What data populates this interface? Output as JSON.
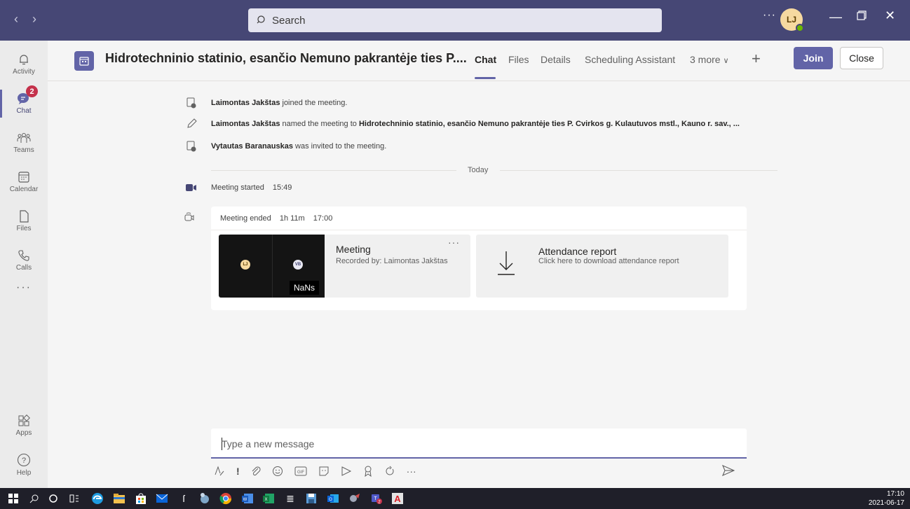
{
  "titlebar": {
    "search_placeholder": "Search",
    "more_label": "···",
    "avatar_initials": "LJ"
  },
  "rail": {
    "items": [
      {
        "label": "Activity",
        "icon": "bell-icon"
      },
      {
        "label": "Chat",
        "icon": "chat-icon",
        "badge": "2"
      },
      {
        "label": "Teams",
        "icon": "teams-icon"
      },
      {
        "label": "Calendar",
        "icon": "calendar-icon"
      },
      {
        "label": "Files",
        "icon": "file-icon"
      },
      {
        "label": "Calls",
        "icon": "phone-icon"
      },
      {
        "label": "Apps",
        "icon": "apps-icon"
      },
      {
        "label": "Help",
        "icon": "help-icon"
      }
    ],
    "more_label": "···"
  },
  "header": {
    "title": "Hidrotechninio statinio, esančio Nemuno pakrantėje ties P....",
    "tabs": [
      "Chat",
      "Files",
      "Details",
      "Scheduling Assistant",
      "3 more"
    ],
    "active_tab": "Chat",
    "join_label": "Join",
    "close_label": "Close"
  },
  "events": [
    {
      "name": "Laimontas Jakštas",
      "text": " joined the meeting."
    },
    {
      "name": "Laimontas Jakštas",
      "text": " named the meeting to ",
      "name2": "Hidrotechninio statinio, esančio Nemuno pakrantėje ties P. Cvirkos g. Kulautuvos mstl., Kauno r. sav., ..."
    },
    {
      "name": "Vytautas Baranauskas",
      "text": " was invited to the meeting."
    }
  ],
  "divider_label": "Today",
  "meeting_started": {
    "label": "Meeting started",
    "time": "15:49"
  },
  "card": {
    "ended_label": "Meeting ended",
    "duration": "1h 11m",
    "time": "17:00",
    "recording": {
      "title": "Meeting",
      "subtitle": "Recorded by: Laimontas Jakštas",
      "more": "···",
      "participants": [
        "LJ",
        "VB"
      ],
      "duration_overlay": "NaNs"
    },
    "attendance": {
      "title": "Attendance report",
      "subtitle": "Click here to download attendance report"
    }
  },
  "compose": {
    "placeholder": "Type a new message",
    "more": "···"
  },
  "taskbar": {
    "time": "17:10",
    "date": "2021-06-17"
  },
  "colors": {
    "titlebar": "#464775",
    "accent": "#6264a7",
    "badge": "#c4314b"
  }
}
